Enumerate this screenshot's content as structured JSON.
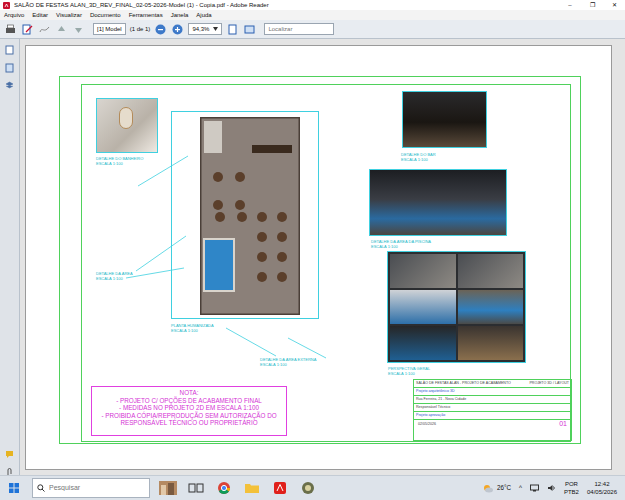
{
  "window": {
    "title": "SALÃO DE FESTAS ALAN_3D_REV_FINAL_02-05-2026-Model (1) - Copia.pdf - Adobe Reader",
    "controls": [
      "–",
      "❐",
      "✕"
    ]
  },
  "menu": [
    "Arquivo",
    "Editar",
    "Visualizar",
    "Documento",
    "Ferramentas",
    "Janela",
    "Ajuda"
  ],
  "toolbar": {
    "page_field": "[1] Model",
    "page_count": "(1 de 1)",
    "zoom": "94,3%",
    "search": {
      "placeholder": "Localizar"
    }
  },
  "sheet": {
    "labels": [
      {
        "title": "DETALHE DO BANHEIRO",
        "scale": "ESCALA 1:100"
      },
      {
        "title": "DETALHE DO BAR",
        "scale": "ESCALA 1:100"
      },
      {
        "title": "DETALHE DA ÁREA DA PISCINA",
        "scale": "ESCALA 1:100"
      },
      {
        "title": "DETALHE DA ÁREA",
        "scale": "ESCALA 1:100"
      },
      {
        "title": "PERSPECTIVA GERAL",
        "scale": "ESCALA 1:100"
      },
      {
        "title": "PLANTA HUMANIZADA",
        "scale": "ESCALA 1:100"
      },
      {
        "title": "DETALHE DA ÁREA EXTERNA",
        "scale": "ESCALA 1:100"
      }
    ],
    "note": {
      "title": "NOTA:",
      "lines": [
        "-      PROJETO C/ OPÇÕES DE ACABAMENTO FINAL",
        "-      MEDIDAS NO PROJETO 2D EM ESCALA 1:100",
        "-      PROIBIDA CÓPIA/REPRODUÇÃO SEM AUTORIZAÇÃO DO RESPONSÁVEL TÉCNICO OU PROPRIETÁRIO"
      ]
    },
    "title_block": {
      "rows": [
        {
          "left": "SALÃO DE FESTAS ALAN - PROJETO DE ACABAMENTO",
          "right": "PROJETO 3D / LAYOUT"
        },
        {
          "left": "Projeto arquitetônico 3D",
          "right": ""
        },
        {
          "left": "Rua Ferreira, 21 - Nova Cidade",
          "right": ""
        },
        {
          "left": "Responsável Técnico",
          "right": ""
        },
        {
          "left": "Projeto aprovação",
          "right": ""
        }
      ],
      "sheet_number": "01",
      "date": "02/05/2026"
    }
  },
  "taskbar": {
    "search": {
      "placeholder": "Pesquisar"
    },
    "weather": "26°C",
    "language": [
      "POR",
      "PTB2"
    ],
    "time": "12:42",
    "date": "04/05/2026",
    "tray": "^"
  }
}
